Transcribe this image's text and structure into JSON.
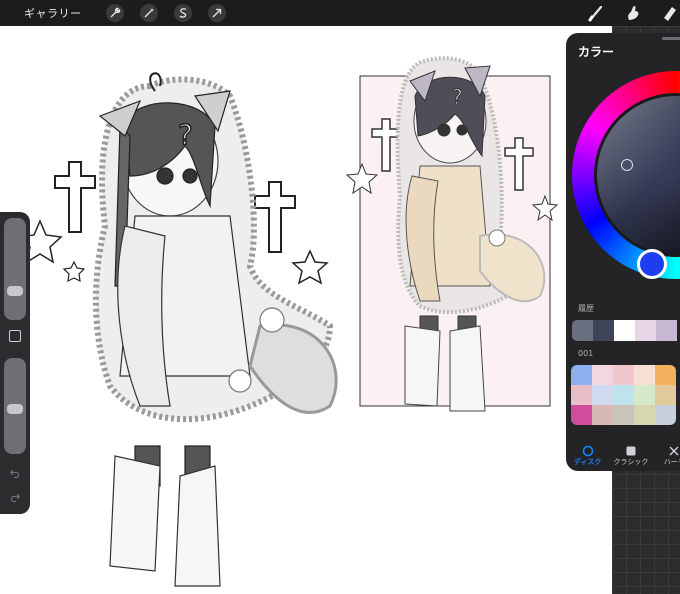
{
  "topbar": {
    "gallery_label": "ギャラリー",
    "left_tools": [
      {
        "name": "actions-wrench-icon"
      },
      {
        "name": "adjustments-wand-icon"
      },
      {
        "name": "selection-s-icon"
      },
      {
        "name": "transform-arrow-icon"
      }
    ],
    "right_tools": [
      {
        "name": "brush-icon"
      },
      {
        "name": "smudge-icon"
      },
      {
        "name": "eraser-icon"
      }
    ]
  },
  "sidebar": {
    "size_slider_value": 0.6,
    "opacity_slider_value": 0.55
  },
  "color_panel": {
    "title": "カラー",
    "history_label": "履歴",
    "palette_label": "001",
    "current_color": "#1d3ef0",
    "history_colors": [
      "#6b7080",
      "#3f4458",
      "#ffffff",
      "#e6d6e6",
      "#c9b8d3"
    ],
    "palette_colors": [
      "#8fb0ee",
      "#f3d7de",
      "#f1c7cc",
      "#f5dfd7",
      "#f3b35e",
      "#e7bfc9",
      "#cfd9ef",
      "#bfe3ea",
      "#d5e8c7",
      "#e2c99b",
      "#d04d9c",
      "#d8b8b3",
      "#c9c3ba",
      "#d6d7b1",
      "#c7d0dc"
    ],
    "tabs": [
      {
        "label": "ディスク",
        "active": true
      },
      {
        "label": "クラシック",
        "active": false
      },
      {
        "label": "ハーモ",
        "active": false
      }
    ]
  }
}
